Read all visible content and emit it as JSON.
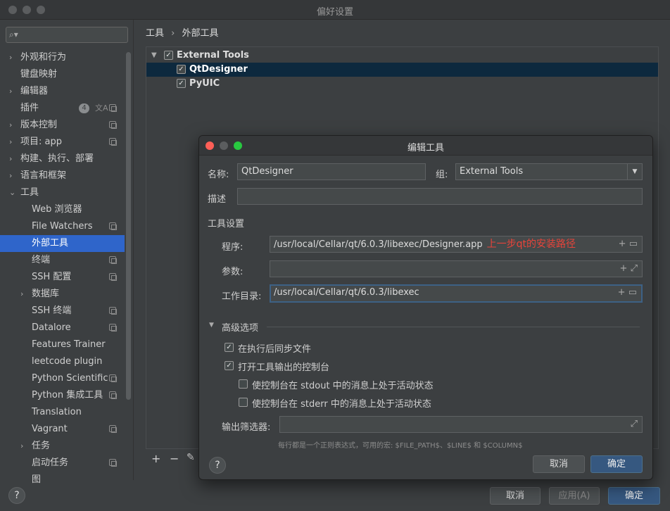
{
  "window": {
    "title": "偏好设置"
  },
  "sidebar": {
    "search_placeholder": "",
    "items": [
      {
        "label": "外观和行为",
        "expandable": true
      },
      {
        "label": "键盘映射"
      },
      {
        "label": "编辑器",
        "expandable": true
      },
      {
        "label": "插件",
        "badge": "4",
        "trans": "文A"
      },
      {
        "label": "版本控制",
        "expandable": true
      },
      {
        "label": "项目: app",
        "expandable": true
      },
      {
        "label": "构建、执行、部署",
        "expandable": true
      },
      {
        "label": "语言和框架",
        "expandable": true
      },
      {
        "label": "工具",
        "expanded": true
      },
      {
        "label": "Web 浏览器"
      },
      {
        "label": "File Watchers"
      },
      {
        "label": "外部工具",
        "selected": true
      },
      {
        "label": "终端"
      },
      {
        "label": "SSH 配置"
      },
      {
        "label": "数据库",
        "expandable": true
      },
      {
        "label": "SSH 终端"
      },
      {
        "label": "Datalore"
      },
      {
        "label": "Features Trainer"
      },
      {
        "label": "leetcode plugin"
      },
      {
        "label": "Python Scientific"
      },
      {
        "label": "Python 集成工具"
      },
      {
        "label": "Translation"
      },
      {
        "label": "Vagrant"
      },
      {
        "label": "任务",
        "expandable": true
      },
      {
        "label": "启动任务"
      },
      {
        "label": "图"
      }
    ]
  },
  "breadcrumb": {
    "root": "工具",
    "sep": "›",
    "current": "外部工具"
  },
  "tree": {
    "group": "External Tools",
    "tools": [
      "QtDesigner",
      "PyUIC"
    ]
  },
  "toolbar": {
    "add": "+",
    "remove": "−",
    "edit": "✎"
  },
  "footer": {
    "help": "?",
    "cancel": "取消",
    "apply": "应用(A)",
    "ok": "确定"
  },
  "dialog": {
    "title": "编辑工具",
    "name_label": "名称:",
    "name_value": "QtDesigner",
    "group_label": "组:",
    "group_value": "External Tools",
    "desc_label": "描述",
    "desc_value": "",
    "tool_settings": "工具设置",
    "program_label": "程序:",
    "program_value": "/usr/local/Cellar/qt/6.0.3/libexec/Designer.app",
    "program_note": "上一步qt的安装路径",
    "args_label": "参数:",
    "args_value": "",
    "workdir_label": "工作目录:",
    "workdir_value": "/usr/local/Cellar/qt/6.0.3/libexec",
    "advanced": "高级选项",
    "sync_files": "在执行后同步文件",
    "open_console": "打开工具输出的控制台",
    "stdout_active": "使控制台在 stdout 中的消息上处于活动状态",
    "stderr_active": "使控制台在 stderr 中的消息上处于活动状态",
    "output_filter_label": "输出筛选器:",
    "output_filter_value": "",
    "hint": "每行都是一个正则表达式，可用的宏: $FILE_PATH$、$LINE$ 和 $COLUMN$",
    "help": "?",
    "cancel": "取消",
    "ok": "确定"
  },
  "colors": {
    "accent": "#2f65ca",
    "primary_button": "#365880",
    "annotation": "#e8443a"
  }
}
